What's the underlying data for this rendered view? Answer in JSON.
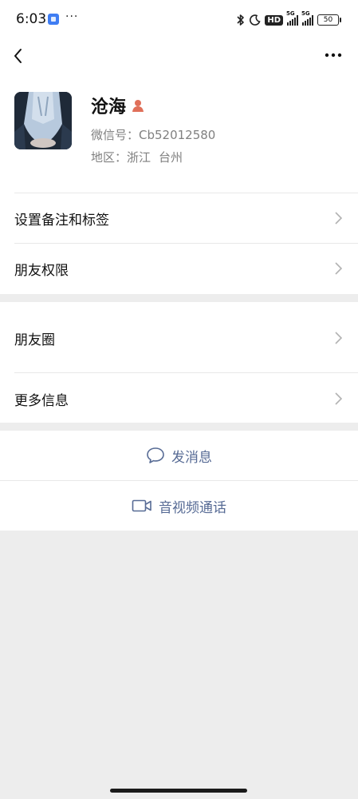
{
  "status_bar": {
    "time": "6:03",
    "ellipsis": "···",
    "hd_label": "HD",
    "signal_label": "5G",
    "battery": "50"
  },
  "profile": {
    "name": "沧海",
    "wechat_id": "微信号：Cb52012580",
    "region_label": "地区：",
    "region_province": "浙江",
    "region_city": "台州"
  },
  "menu": {
    "remarks_tags": "设置备注和标签",
    "friend_permissions": "朋友权限",
    "moments": "朋友圈",
    "more_info": "更多信息"
  },
  "actions": {
    "send_message": "发消息",
    "video_call": "音视频通话"
  },
  "colors": {
    "link": "#576b95",
    "gender_icon": "#e0705a",
    "background": "#ededed"
  },
  "icons": {
    "back": "chevron-left-icon",
    "more": "more-horizontal-icon",
    "gender": "female-person-icon",
    "message": "chat-bubble-icon",
    "video": "video-camera-icon"
  }
}
